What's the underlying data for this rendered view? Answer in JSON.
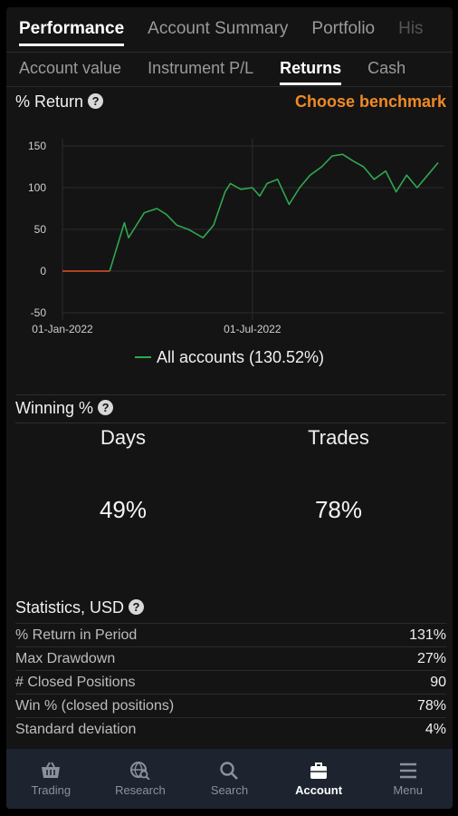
{
  "tabs_top": [
    {
      "label": "Performance",
      "active": true
    },
    {
      "label": "Account Summary",
      "active": false
    },
    {
      "label": "Portfolio",
      "active": false
    },
    {
      "label": "His",
      "active": false
    }
  ],
  "tabs_sub": [
    {
      "label": "Account value",
      "active": false
    },
    {
      "label": "Instrument P/L",
      "active": false
    },
    {
      "label": "Returns",
      "active": true
    },
    {
      "label": "Cash",
      "active": false
    }
  ],
  "returns": {
    "title": "% Return",
    "help": "?",
    "benchmark_label": "Choose benchmark"
  },
  "chart_data": {
    "type": "line",
    "title": "",
    "xlabel": "",
    "ylabel": "",
    "ylim": [
      -50,
      150
    ],
    "yticks": [
      150,
      100,
      50,
      0,
      -50
    ],
    "xtick_labels": [
      "01-Jan-2022",
      "01-Jul-2022"
    ],
    "grid": true,
    "legend": "bottom",
    "series": [
      {
        "name": "All accounts (130.52%)",
        "color": "#2fa84f",
        "pre_color": "#e0522a",
        "x": [
          "2022-01-01",
          "2022-02-15",
          "2022-03-01",
          "2022-03-05",
          "2022-03-10",
          "2022-03-20",
          "2022-04-01",
          "2022-04-10",
          "2022-04-20",
          "2022-05-01",
          "2022-05-15",
          "2022-05-25",
          "2022-06-05",
          "2022-06-10",
          "2022-06-20",
          "2022-07-01",
          "2022-07-08",
          "2022-07-15",
          "2022-07-25",
          "2022-08-05",
          "2022-08-15",
          "2022-08-25",
          "2022-09-05",
          "2022-09-15",
          "2022-09-25",
          "2022-10-05",
          "2022-10-15",
          "2022-10-25",
          "2022-11-05",
          "2022-11-15",
          "2022-11-25",
          "2022-12-05",
          "2022-12-15",
          "2022-12-25"
        ],
        "values": [
          0,
          0,
          58,
          40,
          50,
          70,
          75,
          68,
          55,
          50,
          40,
          55,
          95,
          105,
          98,
          100,
          90,
          105,
          110,
          80,
          100,
          115,
          125,
          138,
          140,
          132,
          125,
          110,
          120,
          95,
          115,
          100,
          115,
          130
        ]
      }
    ]
  },
  "winning": {
    "title": "Winning %",
    "help": "?",
    "days_label": "Days",
    "days_value": "49%",
    "trades_label": "Trades",
    "trades_value": "78%"
  },
  "stats": {
    "title": "Statistics, USD",
    "help": "?",
    "rows": [
      {
        "label": "% Return in Period",
        "value": "131%"
      },
      {
        "label": "Max Drawdown",
        "value": "27%"
      },
      {
        "label": "# Closed Positions",
        "value": "90"
      },
      {
        "label": "Win % (closed positions)",
        "value": "78%"
      },
      {
        "label": "Standard deviation",
        "value": "4%"
      }
    ]
  },
  "bottom_nav": [
    {
      "label": "Trading",
      "icon": "basket-icon",
      "active": false
    },
    {
      "label": "Research",
      "icon": "globe-search-icon",
      "active": false
    },
    {
      "label": "Search",
      "icon": "search-icon",
      "active": false
    },
    {
      "label": "Account",
      "icon": "briefcase-icon",
      "active": true
    },
    {
      "label": "Menu",
      "icon": "hamburger-icon",
      "active": false
    }
  ]
}
